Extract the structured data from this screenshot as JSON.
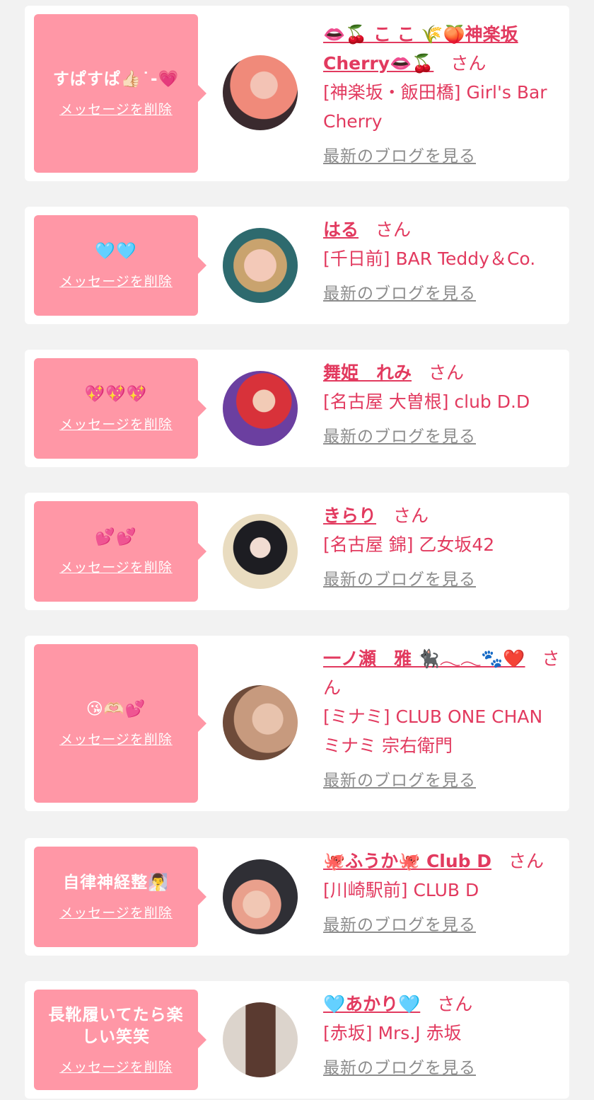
{
  "items": [
    {
      "message": "すぱすぱ👍🏻˙-💗",
      "delete_label": "メッセージを削除",
      "name": "👄🍒 こ こ 🌾🍑神楽坂Cherry👄🍒",
      "suffix": "さん",
      "shop": "[神楽坂・飯田橋] Girl's Bar Cherry",
      "blog_label": "最新のブログを見る",
      "avatar_colors": [
        "#f08a7a",
        "#3a2a2e"
      ]
    },
    {
      "message": "🩵🩵",
      "delete_label": "メッセージを削除",
      "name": "はる",
      "suffix": "さん",
      "shop": "[千日前] BAR Teddy＆Co.",
      "blog_label": "最新のブログを見る",
      "avatar_colors": [
        "#f3c9b8",
        "#2e6a6e"
      ]
    },
    {
      "message": "💖💖💖",
      "delete_label": "メッセージを削除",
      "name": "舞姫　れみ",
      "suffix": "さん",
      "shop": "[名古屋 大曽根] club D.D",
      "blog_label": "最新のブログを見る",
      "avatar_colors": [
        "#d8323a",
        "#6b3fa0"
      ]
    },
    {
      "message": "💕💕",
      "delete_label": "メッセージを削除",
      "name": "きらり",
      "suffix": "さん",
      "shop": "[名古屋 錦] 乙女坂42",
      "blog_label": "最新のブログを見る",
      "avatar_colors": [
        "#1d1d22",
        "#e9dcc0"
      ]
    },
    {
      "message": "😘🫶🏻💕",
      "delete_label": "メッセージを削除",
      "name": "一ノ瀬　雅 🐈‍⬛𓂃𓂃🐾❤️",
      "suffix": "さん",
      "shop": "[ミナミ] CLUB ONE CHAN ミナミ 宗右衛門",
      "blog_label": "最新のブログを見る",
      "avatar_colors": [
        "#c79a7e",
        "#6e4b3a"
      ]
    },
    {
      "message": "自律神経整🧖‍♂️",
      "delete_label": "メッセージを削除",
      "name": "🐙ふうか🐙 Club D",
      "suffix": "さん",
      "shop": "[川崎駅前] CLUB D",
      "blog_label": "最新のブログを見る",
      "avatar_colors": [
        "#e9a08c",
        "#2f2f35"
      ]
    },
    {
      "message": "長靴履いてたら楽しい笑笑",
      "delete_label": "メッセージを削除",
      "name": "🩵あかり🩵",
      "suffix": "さん",
      "shop": "[赤坂] Mrs.J 赤坂",
      "blog_label": "最新のブログを見る",
      "avatar_colors": [
        "#5a3a30",
        "#dcd4cc"
      ]
    }
  ],
  "colors": {
    "accent": "#e23a5f",
    "bubble": "#ff97a6",
    "link_gray": "#8c8c8c",
    "background": "#f2f2f2"
  }
}
